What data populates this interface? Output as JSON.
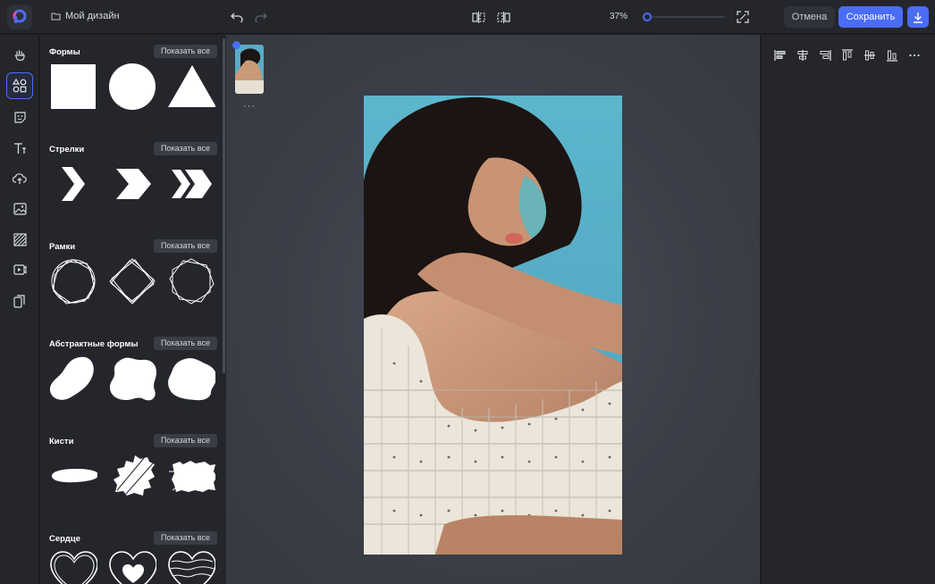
{
  "app": {
    "project_name": "Мой дизайн",
    "zoom": "37%",
    "zoom_level": 0.37,
    "cancel_label": "Отмена",
    "save_label": "Сохранить",
    "accent_color": "#4a6cf7"
  },
  "toolbar_icons": [
    "logo-icon",
    "folder-icon",
    "undo-icon",
    "redo-icon",
    "flip-horizontal-icon",
    "flip-vertical-icon",
    "fit-screen-icon",
    "download-icon"
  ],
  "rail": {
    "items": [
      {
        "name": "templates",
        "icon": "hand-icon"
      },
      {
        "name": "elements",
        "icon": "shapes-icon",
        "active": true
      },
      {
        "name": "stickers",
        "icon": "sticker-icon"
      },
      {
        "name": "text",
        "icon": "text-icon"
      },
      {
        "name": "uploads",
        "icon": "cloud-upload-icon"
      },
      {
        "name": "photos",
        "icon": "image-icon"
      },
      {
        "name": "backgrounds",
        "icon": "pattern-icon"
      },
      {
        "name": "video",
        "icon": "video-icon"
      },
      {
        "name": "layers",
        "icon": "copy-icon"
      }
    ]
  },
  "sections": [
    {
      "title": "Формы",
      "show_all": "Показать все"
    },
    {
      "title": "Стрелки",
      "show_all": "Показать все"
    },
    {
      "title": "Рамки",
      "show_all": "Показать все"
    },
    {
      "title": "Абстрактные формы",
      "show_all": "Показать все"
    },
    {
      "title": "Кисти",
      "show_all": "Показать все"
    },
    {
      "title": "Сердце",
      "show_all": "Показать все"
    }
  ],
  "canvas": {
    "page_more": "···"
  },
  "align_icons": [
    "align-left-icon",
    "align-center-horizontal-icon",
    "align-right-icon",
    "align-top-icon",
    "align-middle-icon",
    "align-bottom-icon",
    "more-icon"
  ]
}
